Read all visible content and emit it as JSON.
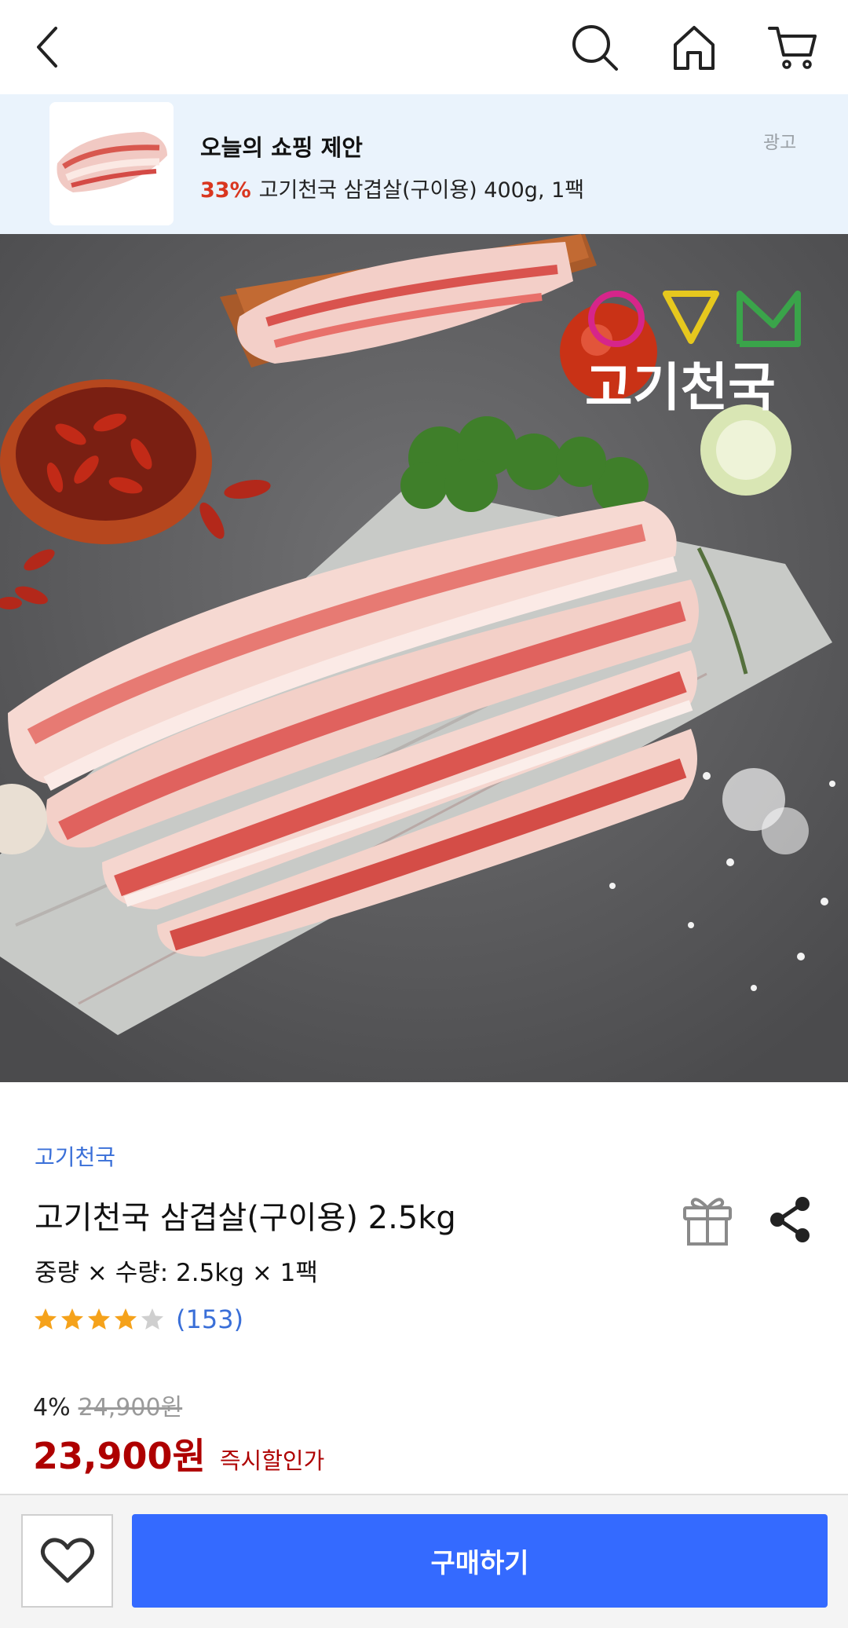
{
  "header": {
    "back_icon": "chevron-left-icon",
    "search_icon": "search-icon",
    "home_icon": "home-icon",
    "cart_icon": "cart-icon"
  },
  "ad_banner": {
    "title": "오늘의 쇼핑 제안",
    "discount": "33%",
    "product": "고기천국 삼겹살(구이용) 400g, 1팩",
    "tag": "광고"
  },
  "hero": {
    "logo_text": "고기천국"
  },
  "product": {
    "brand": "고기천국",
    "name": "고기천국 삼겹살(구이용) 2.5kg",
    "option": "중량 × 수량: 2.5kg × 1팩",
    "rating": 4,
    "rating_max": 5,
    "review_count": "(153)",
    "discount_rate": "4%",
    "original_price": "24,900원",
    "price": "23,900원",
    "price_note": "즉시할인가"
  },
  "bottom_bar": {
    "wishlist_icon": "heart-icon",
    "buy_label": "구매하기"
  },
  "colors": {
    "accent": "#346aff",
    "price": "#ae0000",
    "link": "#3a6fd8",
    "ad_bg": "#eaf3fc",
    "star": "#f5a21b"
  }
}
